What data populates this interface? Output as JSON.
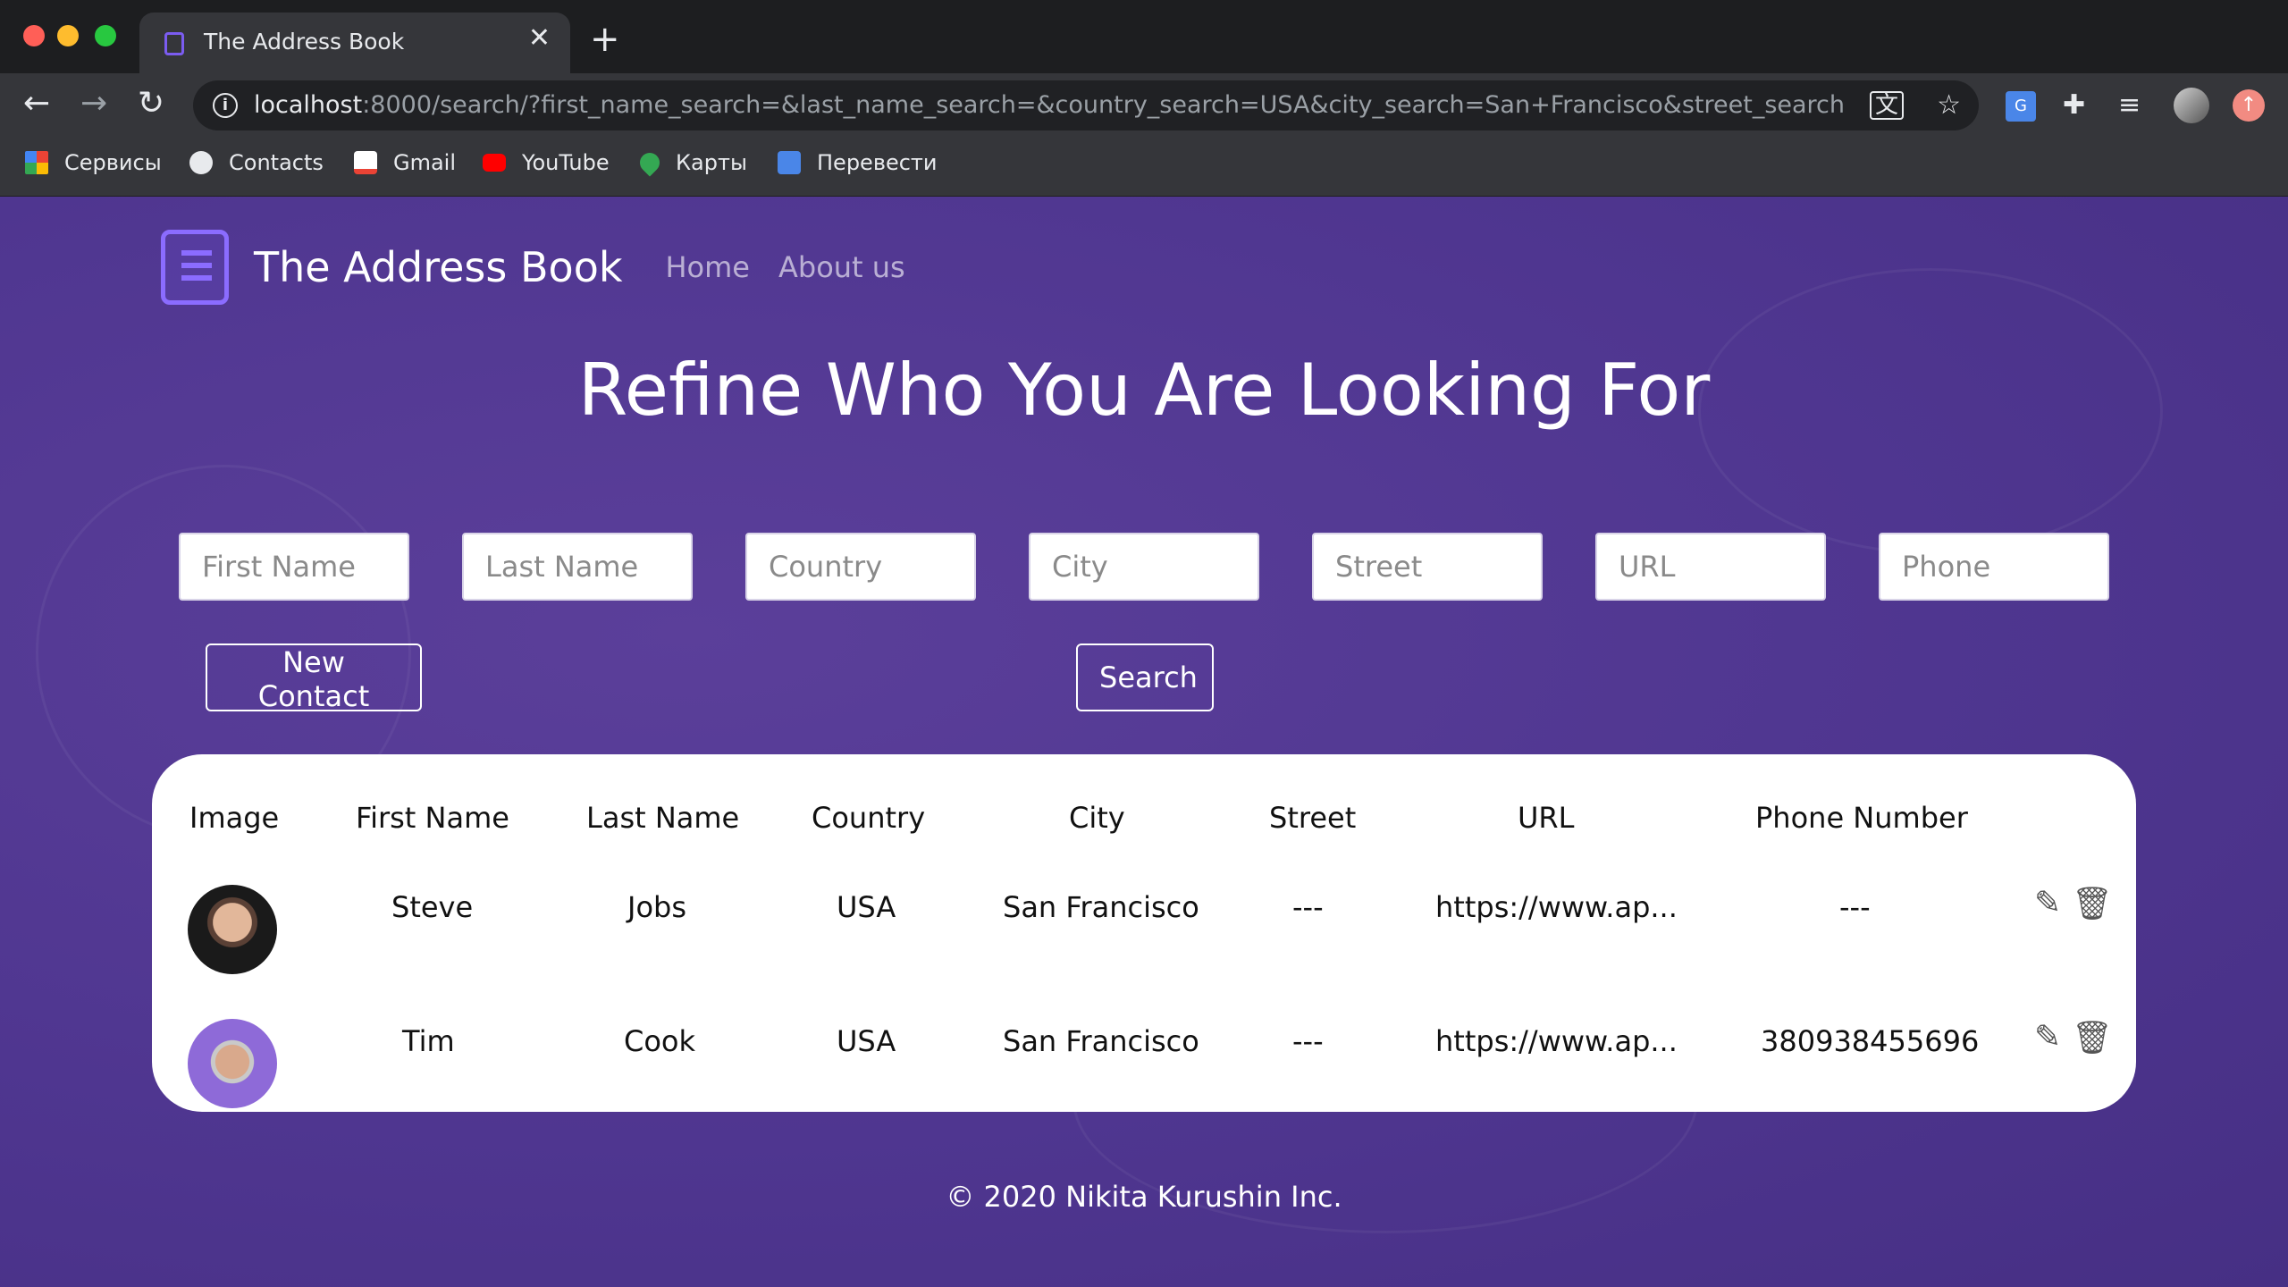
{
  "browser": {
    "tab_title": "The Address Book",
    "url_host": "localhost",
    "url_rest": ":8000/search/?first_name_search=&last_name_search=&country_search=USA&city_search=San+Francisco&street_search=&...",
    "bookmarks": [
      "Сервисы",
      "Contacts",
      "Gmail",
      "YouTube",
      "Карты",
      "Перевести"
    ]
  },
  "nav": {
    "brand": "The Address Book",
    "links": [
      "Home",
      "About us"
    ]
  },
  "headline": "Refine Who You Are Looking For",
  "filters": {
    "placeholders": [
      "First Name",
      "Last Name",
      "Country",
      "City",
      "Street",
      "URL",
      "Phone"
    ]
  },
  "buttons": {
    "new_contact": "New Contact",
    "search": "Search"
  },
  "table": {
    "headers": [
      "Image",
      "First Name",
      "Last Name",
      "Country",
      "City",
      "Street",
      "URL",
      "Phone Number"
    ],
    "rows": [
      {
        "first_name": "Steve",
        "last_name": "Jobs",
        "country": "USA",
        "city": "San Francisco",
        "street": "---",
        "url": "https://www.ap...",
        "phone": "---"
      },
      {
        "first_name": "Tim",
        "last_name": "Cook",
        "country": "USA",
        "city": "San Francisco",
        "street": "---",
        "url": "https://www.ap...",
        "phone": "380938455696"
      }
    ]
  },
  "footer": "© 2020 Nikita Kurushin Inc.",
  "colors": {
    "page_background": "#4f3690",
    "brand_icon": "#8b6cff"
  }
}
